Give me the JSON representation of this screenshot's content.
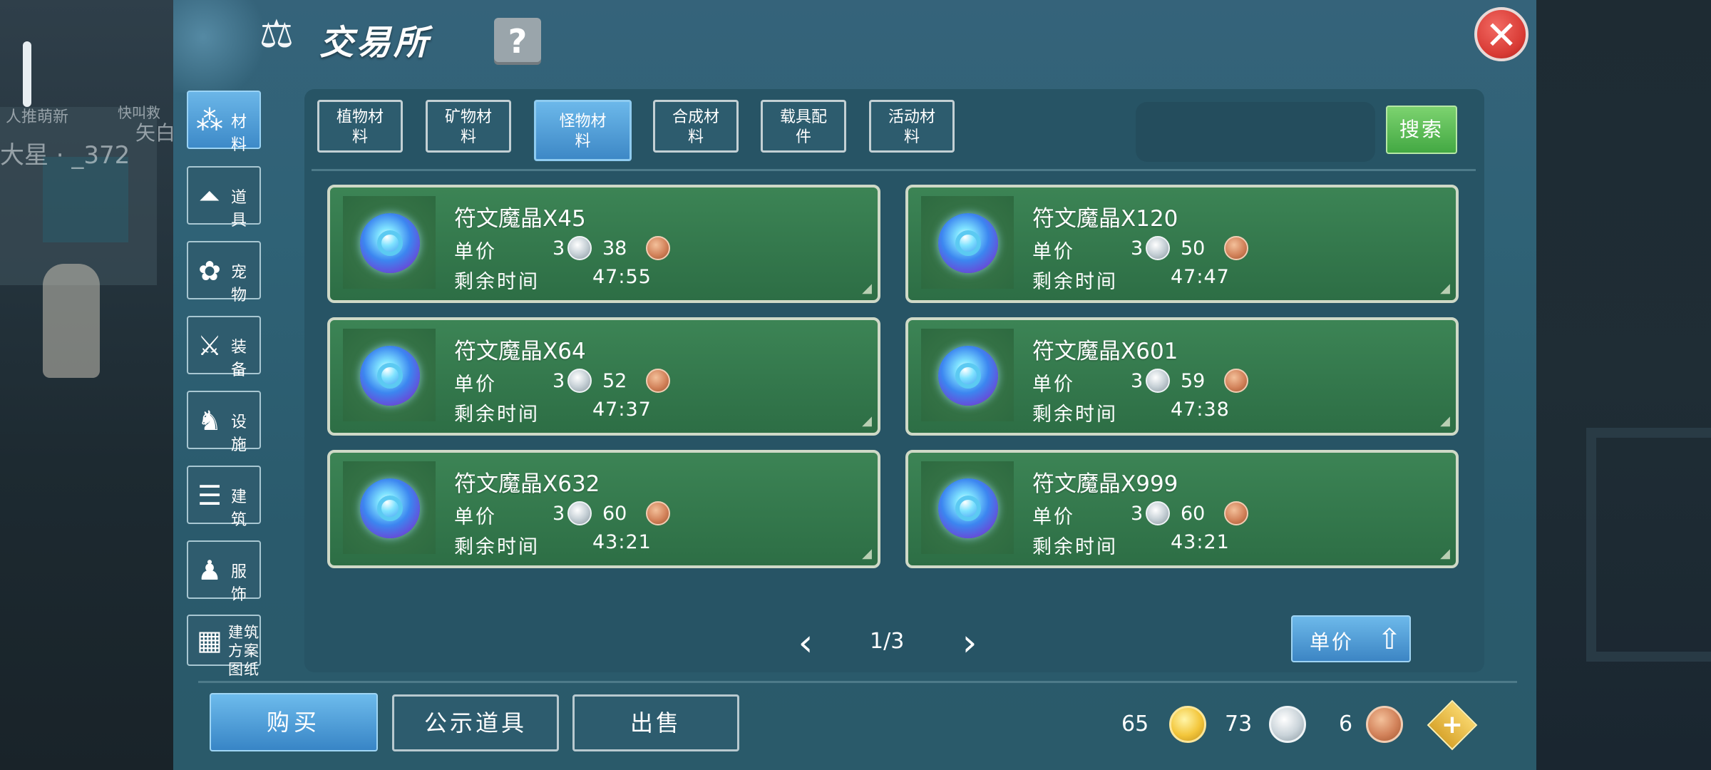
{
  "background": {
    "overlay_texts": [
      "人推萌新",
      "快叫救",
      "大星 · _372",
      "矢白"
    ]
  },
  "header": {
    "title": "交易所",
    "title_icon": "scales-icon",
    "help_label": "?",
    "close_label": "✕"
  },
  "categories": [
    {
      "label": "材料",
      "icon": "materials-icon",
      "active": true
    },
    {
      "label": "道具",
      "icon": "flask-icon",
      "active": false
    },
    {
      "label": "宠物",
      "icon": "paw-icon",
      "active": false
    },
    {
      "label": "装备",
      "icon": "sword-shield-icon",
      "active": false
    },
    {
      "label": "设施",
      "icon": "horse-icon",
      "active": false
    },
    {
      "label": "建筑",
      "icon": "brick-wall-icon",
      "active": false
    },
    {
      "label": "服饰",
      "icon": "clothing-icon",
      "active": false
    },
    {
      "label": "建筑方案图纸",
      "icon": "blueprint-icon",
      "active": false
    }
  ],
  "tabs": [
    {
      "label": "植物材料",
      "active": false
    },
    {
      "label": "矿物材料",
      "active": false
    },
    {
      "label": "怪物材料",
      "active": true
    },
    {
      "label": "合成材料",
      "active": false
    },
    {
      "label": "载具配件",
      "active": false
    },
    {
      "label": "活动材料",
      "active": false
    }
  ],
  "search": {
    "placeholder": "",
    "button_label": "搜索"
  },
  "item_labels": {
    "price": "单价",
    "time": "剩余时间"
  },
  "items": [
    {
      "name": "符文魔晶X45",
      "silver": "3",
      "copper": "38",
      "time": "47:55"
    },
    {
      "name": "符文魔晶X120",
      "silver": "3",
      "copper": "50",
      "time": "47:47"
    },
    {
      "name": "符文魔晶X64",
      "silver": "3",
      "copper": "52",
      "time": "47:37"
    },
    {
      "name": "符文魔晶X601",
      "silver": "3",
      "copper": "59",
      "time": "47:38"
    },
    {
      "name": "符文魔晶X632",
      "silver": "3",
      "copper": "60",
      "time": "43:21"
    },
    {
      "name": "符文魔晶X999",
      "silver": "3",
      "copper": "60",
      "time": "43:21"
    }
  ],
  "pagination": {
    "label": "1/3",
    "prev": "‹",
    "next": "›"
  },
  "sort": {
    "label": "单价"
  },
  "bottom": {
    "buy": "购买",
    "public_items": "公示道具",
    "sell": "出售"
  },
  "currency": {
    "gold": "65",
    "silver": "73",
    "copper": "6"
  },
  "colors": {
    "accent_blue": "#3d8ac8",
    "card_green": "#2d6e45",
    "search_green": "#43a843",
    "close_red": "#d83a34"
  }
}
